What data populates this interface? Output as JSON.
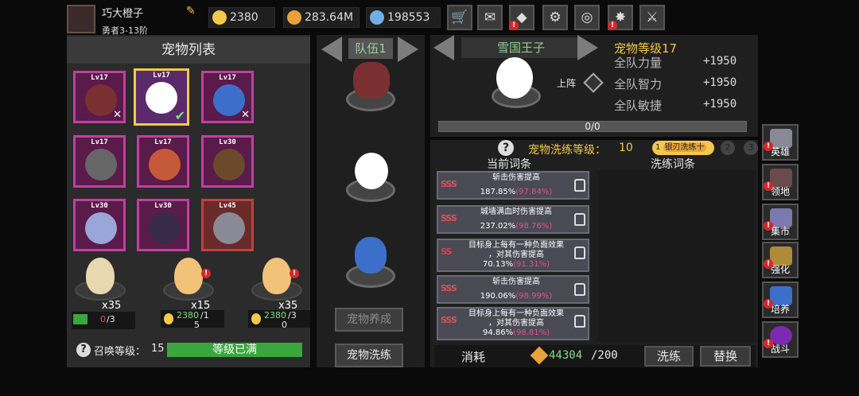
{
  "player": {
    "name": "巧大橙子",
    "rank": "勇者3-13阶"
  },
  "resources": {
    "gold": "2380",
    "coins": "283.64M",
    "gems": "198553"
  },
  "toolbar_icons": [
    "shop-cart-icon",
    "mail-icon",
    "gift-icon",
    "settings-gear-icon",
    "color-wheel-icon",
    "event-icon",
    "sword-icon"
  ],
  "left": {
    "title": "宠物列表",
    "pets": [
      {
        "level": "Lv17",
        "state": "x"
      },
      {
        "level": "Lv17",
        "state": "check"
      },
      {
        "level": "Lv17",
        "state": "x"
      },
      {
        "level": "Lv17",
        "state": ""
      },
      {
        "level": "Lv17",
        "state": ""
      },
      {
        "level": "Lv30",
        "state": ""
      },
      {
        "level": "Lv30",
        "state": ""
      },
      {
        "level": "Lv30",
        "state": ""
      },
      {
        "level": "Lv45",
        "state": ""
      }
    ],
    "eggs": [
      {
        "count": "x35",
        "progress_a": "0",
        "progress_b": "/3",
        "sub": ""
      },
      {
        "count": "x15",
        "progress_a": "2380",
        "progress_b": "/1",
        "sub": "5"
      },
      {
        "count": "x35",
        "progress_a": "2380",
        "progress_b": "/3",
        "sub": "0"
      }
    ],
    "summon_label": "召唤等级：",
    "summon_level": "15",
    "summon_bar": "等级已满"
  },
  "middle": {
    "team_label": "队伍1",
    "btn_raise": "宠物养成",
    "btn_refine": "宠物洗练"
  },
  "right": {
    "pet_name": "雪国王子",
    "pet_level": "宠物等级17",
    "deploy": "上阵",
    "stats": [
      {
        "label": "全队力量",
        "value": "+1950"
      },
      {
        "label": "全队智力",
        "value": "+1950"
      },
      {
        "label": "全队敏捷",
        "value": "+1950"
      }
    ],
    "xp": "0/0",
    "xp_fraction": 0.0,
    "refine_level_label": "宠物洗练等级：",
    "refine_level": "10",
    "tab1": "1",
    "tab1_label": "银刃洗练十",
    "tab2": "2",
    "tab3": "3",
    "col_current": "当前词条",
    "col_refine": "洗练词条",
    "traits": [
      {
        "name": "斩击伤害提高",
        "name2": "",
        "value": "187.85%",
        "pct": "(97.84%)"
      },
      {
        "name": "城墙满血时伤害提高",
        "name2": "",
        "value": "237.02%",
        "pct": "(98.76%)"
      },
      {
        "name": "目标身上每有一种负面效果",
        "name2": "，对其伤害提高",
        "value": "70.13%",
        "pct": "(91.31%)"
      },
      {
        "name": "斩击伤害提高",
        "name2": "",
        "value": "190.06%",
        "pct": "(98.99%)"
      },
      {
        "name": "目标身上每有一种负面效果",
        "name2": "，对其伤害提高",
        "value": "94.86%",
        "pct": "(98.81%)"
      }
    ],
    "cost_label": "消耗",
    "cost_have": "44304",
    "cost_need": "/200",
    "btn_refine": "洗练",
    "btn_replace": "替换"
  },
  "side_menu": [
    {
      "label": "英雄",
      "alert": "!"
    },
    {
      "label": "领地",
      "alert": "!"
    },
    {
      "label": "集市",
      "alert": "!"
    },
    {
      "label": "强化",
      "alert": "!"
    },
    {
      "label": "培养",
      "alert": "!"
    },
    {
      "label": "战斗",
      "alert": "!"
    }
  ],
  "colors": {
    "accent": "#f2c94c",
    "green": "#3aa63f",
    "purple": "#c040a0",
    "danger": "#d8262a"
  }
}
